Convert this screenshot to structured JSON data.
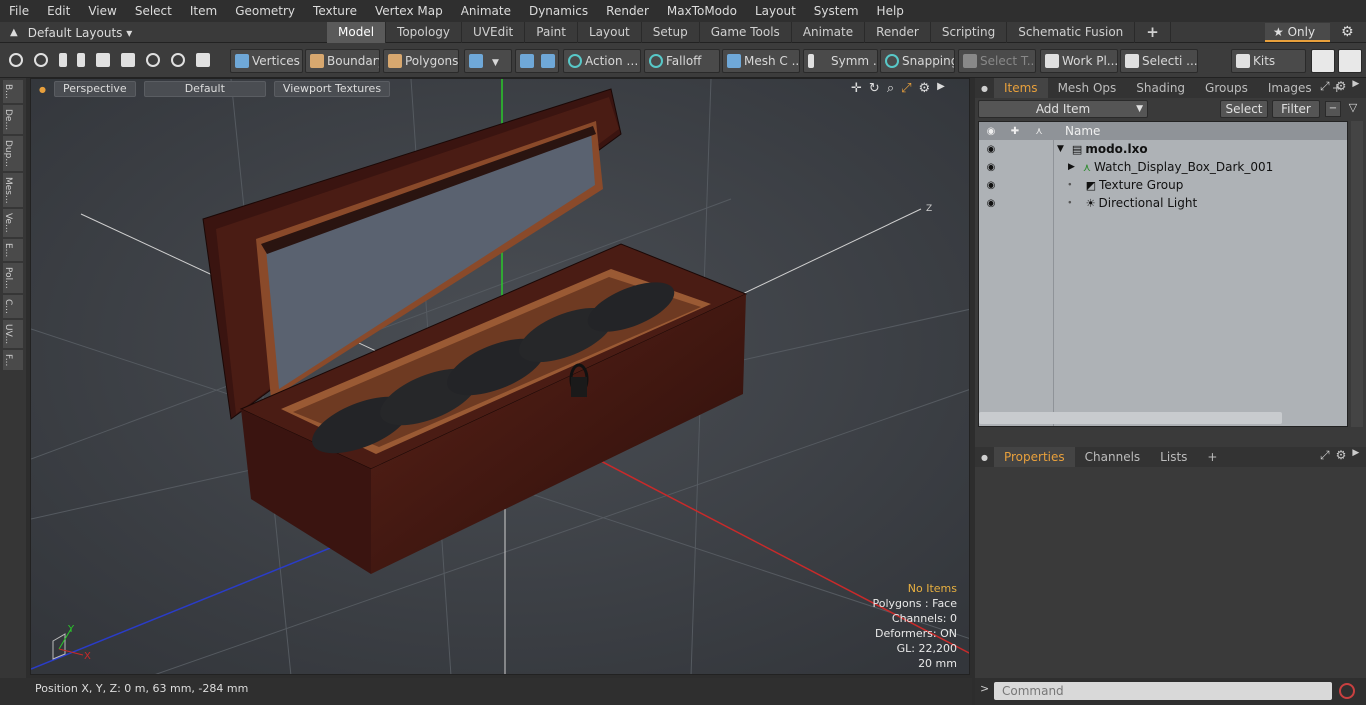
{
  "menu": [
    "File",
    "Edit",
    "View",
    "Select",
    "Item",
    "Geometry",
    "Texture",
    "Vertex Map",
    "Animate",
    "Dynamics",
    "Render",
    "MaxToModo",
    "Layout",
    "System",
    "Help"
  ],
  "layouts": {
    "label": "Default Layouts ▾"
  },
  "modes": [
    "Model",
    "Topology",
    "UVEdit",
    "Paint",
    "Layout",
    "Setup",
    "Game Tools",
    "Animate",
    "Render",
    "Scripting",
    "Schematic Fusion"
  ],
  "only_label": "★ Only",
  "toolbar": {
    "vertices": "Vertices",
    "boundary": "Boundary",
    "polygons": "Polygons",
    "action": "Action",
    "falloff": "Falloff",
    "meshc": "Mesh C ...",
    "symm": "Symm ...",
    "snapping": "Snapping",
    "selectt": "Select T...",
    "workpl": "Work Pl...",
    "selecti": "Selecti ...",
    "kits": "Kits"
  },
  "lefttabs": [
    "B...",
    "De...",
    "Dup...",
    "Mes...",
    "Ve...",
    "E...",
    "Pol...",
    "C...",
    "UV...",
    "F..."
  ],
  "viewport": {
    "perspective": "Perspective",
    "default": "Default",
    "textures": "Viewport Textures",
    "hud": [
      "No Items",
      "Polygons : Face",
      "Channels: 0",
      "Deformers: ON",
      "GL: 22,200",
      "20 mm"
    ],
    "axis_y": "Y",
    "axis_x": "X",
    "axis_z": "Z"
  },
  "status": "Position X, Y, Z:  0 m, 63 mm, -284 mm",
  "panel": {
    "tabs": [
      "Items",
      "Mesh Ops",
      "Shading",
      "Groups",
      "Images",
      "+"
    ],
    "add_item": "Add Item",
    "select": "Select",
    "filter": "Filter",
    "name_header": "Name",
    "items": [
      {
        "name": "modo.lxo"
      },
      {
        "name": "Watch_Display_Box_Dark_001"
      },
      {
        "name": "Texture Group"
      },
      {
        "name": "Directional Light"
      }
    ],
    "props_tabs": [
      "Properties",
      "Channels",
      "Lists",
      "+"
    ]
  },
  "command": {
    "placeholder": "Command"
  },
  "colors": {
    "accent": "#e8a03c",
    "viewport_bg": "#3f4349",
    "list_bg": "#aeb2b6"
  }
}
